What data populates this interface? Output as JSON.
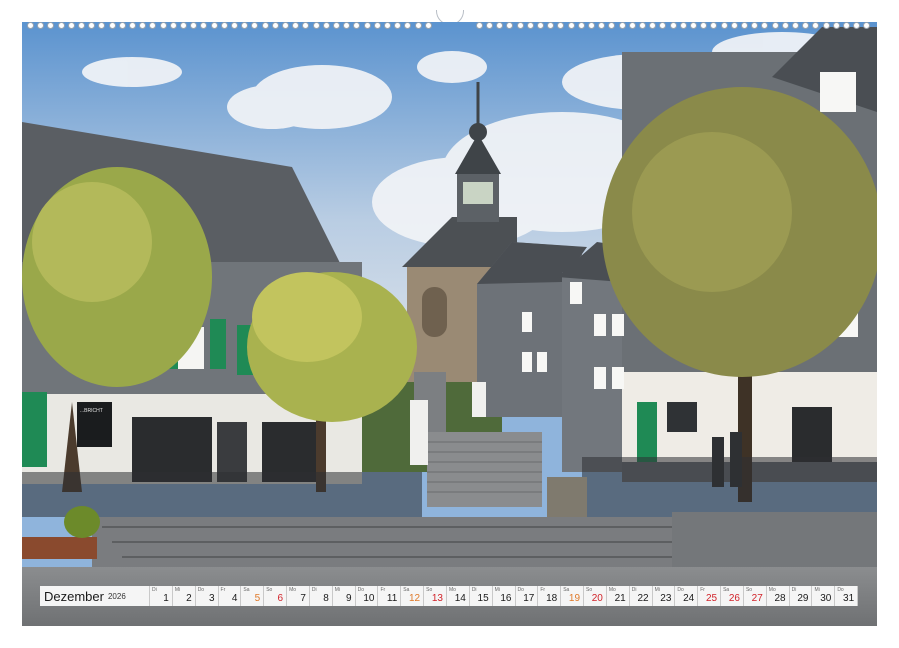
{
  "calendar": {
    "month": "Dezember",
    "year": "2026",
    "days": [
      {
        "n": "1",
        "w": "Di",
        "t": "w"
      },
      {
        "n": "2",
        "w": "Mi",
        "t": "w"
      },
      {
        "n": "3",
        "w": "Do",
        "t": "w"
      },
      {
        "n": "4",
        "w": "Fr",
        "t": "w"
      },
      {
        "n": "5",
        "w": "Sa",
        "t": "sat"
      },
      {
        "n": "6",
        "w": "So",
        "t": "sun"
      },
      {
        "n": "7",
        "w": "Mo",
        "t": "w"
      },
      {
        "n": "8",
        "w": "Di",
        "t": "w"
      },
      {
        "n": "9",
        "w": "Mi",
        "t": "w"
      },
      {
        "n": "10",
        "w": "Do",
        "t": "w"
      },
      {
        "n": "11",
        "w": "Fr",
        "t": "w"
      },
      {
        "n": "12",
        "w": "Sa",
        "t": "sat"
      },
      {
        "n": "13",
        "w": "So",
        "t": "sun"
      },
      {
        "n": "14",
        "w": "Mo",
        "t": "w"
      },
      {
        "n": "15",
        "w": "Di",
        "t": "w"
      },
      {
        "n": "16",
        "w": "Mi",
        "t": "w"
      },
      {
        "n": "17",
        "w": "Do",
        "t": "w"
      },
      {
        "n": "18",
        "w": "Fr",
        "t": "w"
      },
      {
        "n": "19",
        "w": "Sa",
        "t": "sat"
      },
      {
        "n": "20",
        "w": "So",
        "t": "sun"
      },
      {
        "n": "21",
        "w": "Mo",
        "t": "w"
      },
      {
        "n": "22",
        "w": "Di",
        "t": "w"
      },
      {
        "n": "23",
        "w": "Mi",
        "t": "w"
      },
      {
        "n": "24",
        "w": "Do",
        "t": "w"
      },
      {
        "n": "25",
        "w": "Fr",
        "t": "red"
      },
      {
        "n": "26",
        "w": "Sa",
        "t": "red"
      },
      {
        "n": "27",
        "w": "So",
        "t": "sun"
      },
      {
        "n": "28",
        "w": "Mo",
        "t": "w"
      },
      {
        "n": "29",
        "w": "Di",
        "t": "w"
      },
      {
        "n": "30",
        "w": "Mi",
        "t": "w"
      },
      {
        "n": "31",
        "w": "Do",
        "t": "w"
      }
    ]
  },
  "photo": {
    "sign_text": "...BRICHT"
  },
  "colors": {
    "sky": "#8fb4dc",
    "slate": "#5f6366",
    "stone": "#9a8a74",
    "shutter": "#1f8a55",
    "tree": "#9aa84a",
    "sunday": "#d2232a",
    "saturday": "#e07a2a"
  }
}
